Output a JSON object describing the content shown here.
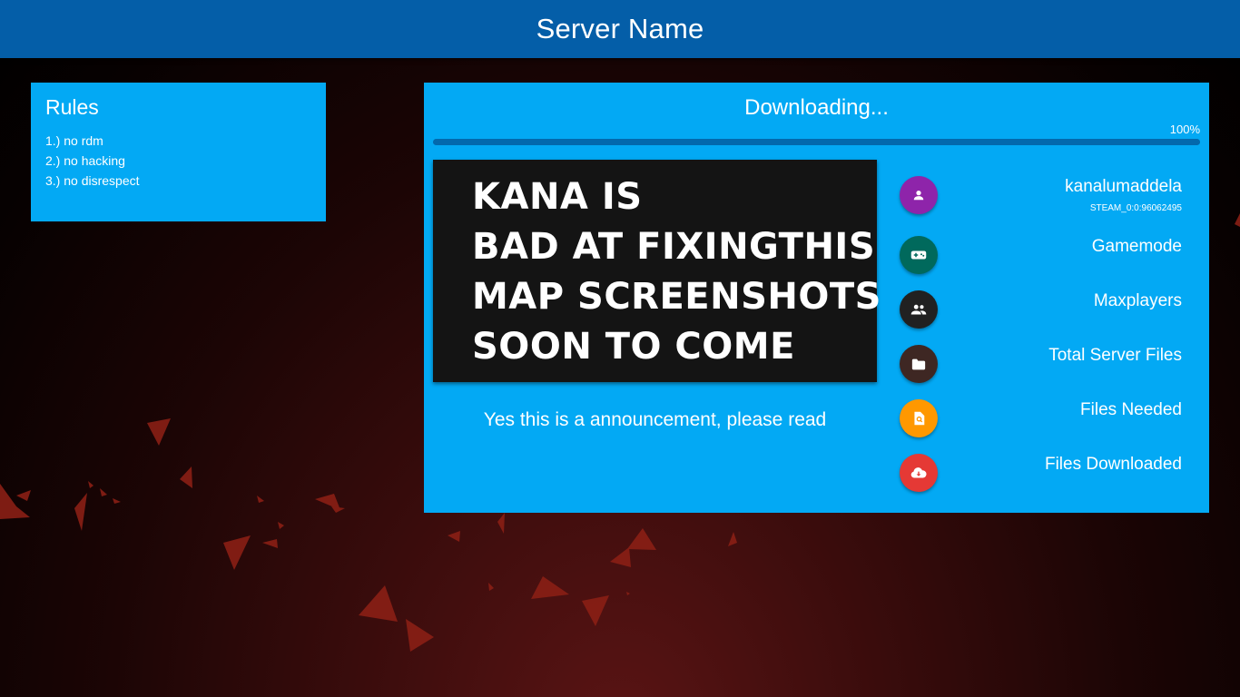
{
  "header": {
    "title": "Server Name"
  },
  "rules": {
    "title": "Rules",
    "items": [
      "1.) no rdm",
      "2.) no hacking",
      "3.) no disrespect"
    ]
  },
  "download": {
    "status": "Downloading...",
    "percent_label": "100%",
    "progress": 1.0
  },
  "announcement": {
    "lines": [
      "KANA IS",
      "BAD AT FIXINGTHIS",
      "MAP SCREENSHOTS",
      "SOON TO COME"
    ],
    "caption": "Yes this is a announcement, please read"
  },
  "info": {
    "player": {
      "name": "kanalumaddela",
      "steam_id": "STEAM_0:0:96062495",
      "icon": "person-icon",
      "color": "#8e24aa"
    },
    "gamemode": {
      "label": "Gamemode",
      "icon": "gamepad-icon",
      "color": "#00695c"
    },
    "maxplayers": {
      "label": "Maxplayers",
      "icon": "group-icon",
      "color": "#212121"
    },
    "total_files": {
      "label": "Total Server Files",
      "icon": "folder-icon",
      "color": "#3e2723"
    },
    "files_needed": {
      "label": "Files Needed",
      "icon": "file-search-icon",
      "color": "#ff9800"
    },
    "files_downloaded": {
      "label": "Files Downloaded",
      "icon": "cloud-download-icon",
      "color": "#e53935"
    }
  }
}
